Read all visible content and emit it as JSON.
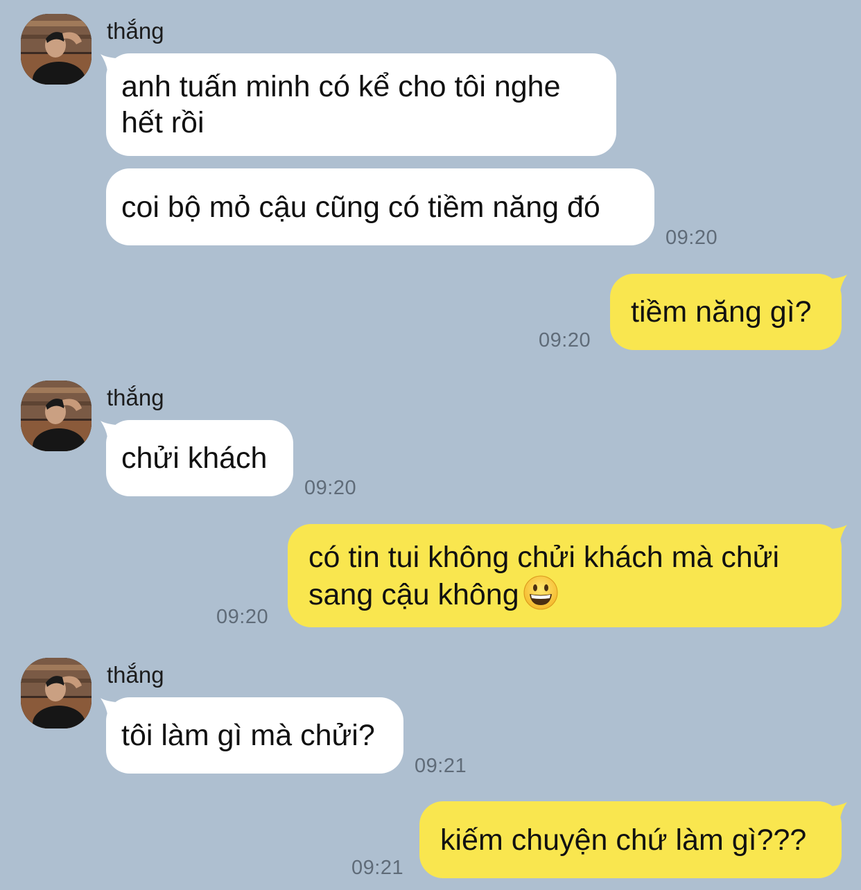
{
  "contact": {
    "name": "thắng"
  },
  "messages": [
    {
      "text_line1": "anh tuấn minh có kể cho tôi nghe",
      "text_line2": "hết rồi"
    },
    {
      "text": "coi bộ mỏ cậu cũng có tiềm năng đó",
      "time": "09:20"
    },
    {
      "text": "tiềm năng gì?",
      "time": "09:20"
    },
    {
      "text": "chửi khách",
      "time": "09:20"
    },
    {
      "text_line1": "có tin tui không chửi khách mà chửi",
      "text_line2": "sang cậu không",
      "emoji": "grinning-face-emoji",
      "time": "09:20"
    },
    {
      "text": "tôi làm gì mà chửi?",
      "time": "09:21"
    },
    {
      "text": "kiếm chuyện chứ làm gì???",
      "time": "09:21"
    }
  ],
  "colors": {
    "background": "#aebfd0",
    "incoming_bubble": "#ffffff",
    "outgoing_bubble": "#f9e64f",
    "timestamp": "#5f6b78"
  }
}
